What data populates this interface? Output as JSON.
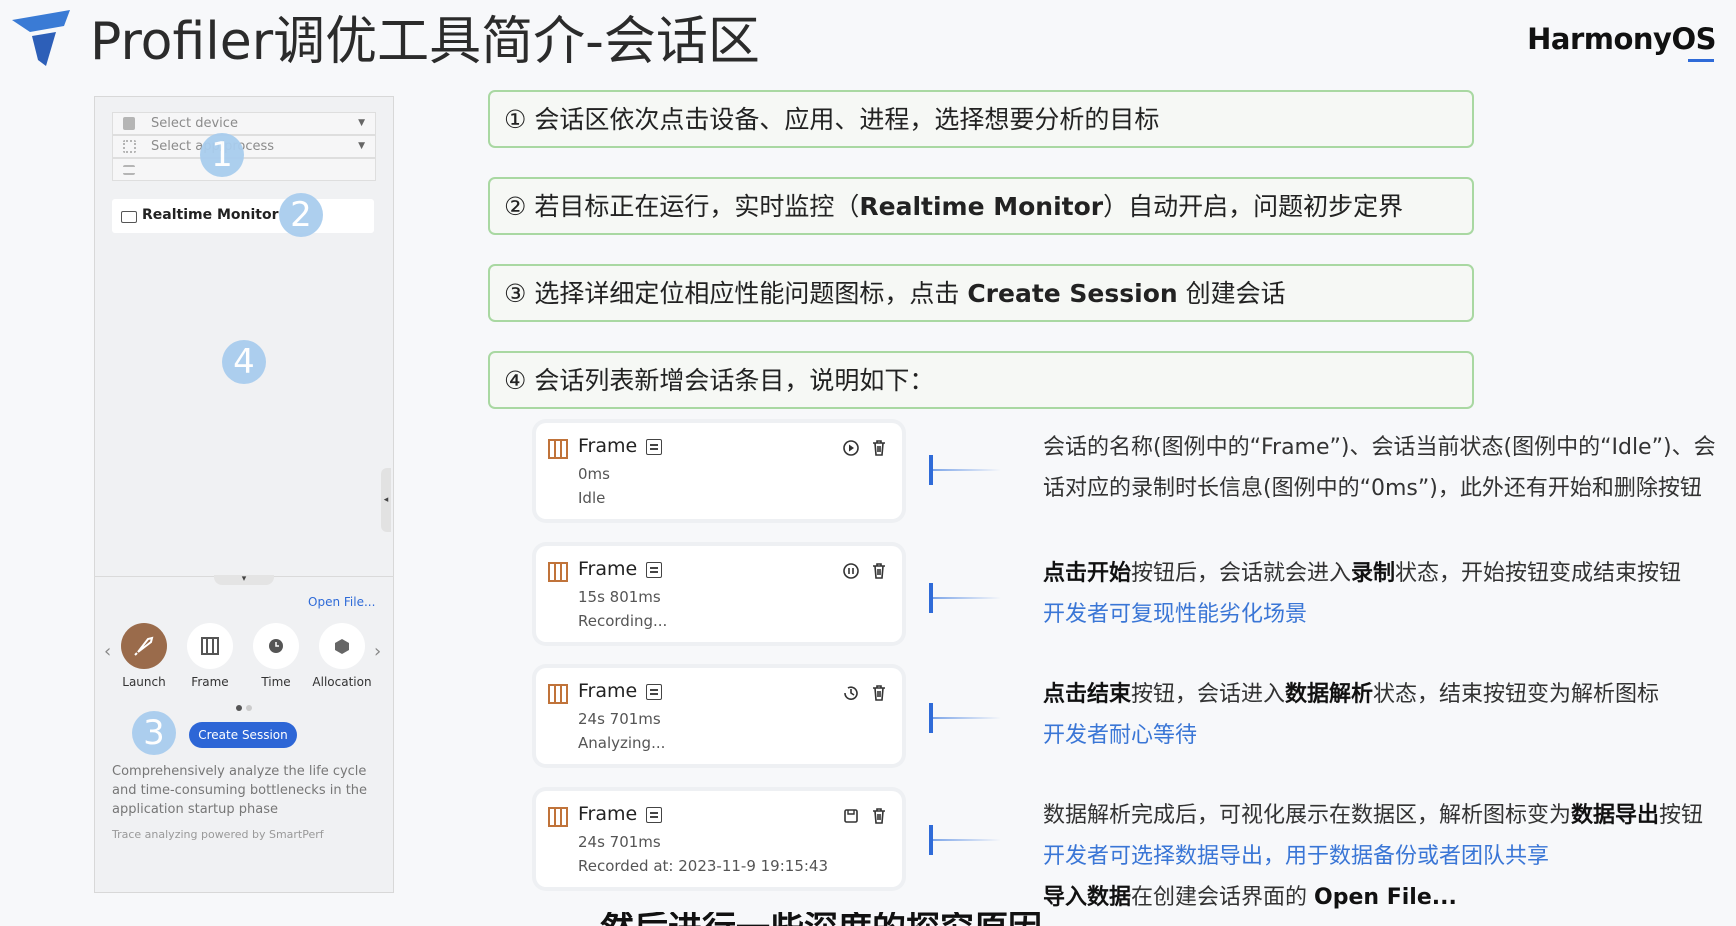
{
  "header": {
    "title": "Profiler调优工具简介-会话区",
    "brand": "HarmonyOS"
  },
  "panel": {
    "select_device": "Select device",
    "select_process": "Select app/process",
    "realtime_monitor": "Realtime Monitor",
    "open_file": "Open File...",
    "tools": [
      {
        "label": "Launch",
        "icon": "rocket-icon"
      },
      {
        "label": "Frame",
        "icon": "frame-icon"
      },
      {
        "label": "Time",
        "icon": "clock-icon"
      },
      {
        "label": "Allocation",
        "icon": "cube-icon"
      }
    ],
    "create_session": "Create Session",
    "description": "Comprehensively analyze the life cycle and time-consuming bottlenecks in the application startup phase",
    "footer": "Trace analyzing powered by SmartPerf",
    "badges": [
      "1",
      "2",
      "3",
      "4"
    ]
  },
  "callouts": {
    "c1": "① 会话区依次点击设备、应用、进程，选择想要分析的目标",
    "c2_pre": "② 若目标正在运行，实时监控（",
    "c2_bold": "Realtime Monitor",
    "c2_post": "）自动开启，问题初步定界",
    "c3_pre": "③ 选择详细定位相应性能问题图标，点击 ",
    "c3_bold": "Create Session",
    "c3_post": " 创建会话",
    "c4": "④ 会话列表新增会话条目，说明如下："
  },
  "sessions": [
    {
      "name": "Frame",
      "duration": "0ms",
      "state": "Idle"
    },
    {
      "name": "Frame",
      "duration": "15s 801ms",
      "state": "Recording..."
    },
    {
      "name": "Frame",
      "duration": "24s 701ms",
      "state": "Analyzing..."
    },
    {
      "name": "Frame",
      "duration": "24s 701ms",
      "state": "Recorded at: 2023-11-9 19:15:43"
    }
  ],
  "descriptions": {
    "d1_l1": "会话的名称(图例中的“Frame”)、会话当前状态(图例中的“Idle”)、会",
    "d1_l2": "话对应的录制时长信息(图例中的“0ms”)，此外还有开始和删除按钮",
    "d2_a": "点击开始",
    "d2_b": "按钮后，会话就会进入",
    "d2_c": "录制",
    "d2_d": "状态，开始按钮变成结束按钮",
    "d2_l2": "开发者可复现性能劣化场景",
    "d3_a": "点击结束",
    "d3_b": "按钮，会话进入",
    "d3_c": "数据解析",
    "d3_d": "状态，结束按钮变为解析图标",
    "d3_l2": "开发者耐心等待",
    "d4_a": "数据解析完成后，可视化展示在数据区，解析图标变为",
    "d4_b": "数据导出",
    "d4_c": "按钮",
    "d4_l2": "开发者可选择数据导出，用于数据备份或者团队共享",
    "d4_l3a": "导入数据",
    "d4_l3b": "在创建会话界面的 ",
    "d4_l3c": "Open File..."
  },
  "subtitle": "然后进行一些深度的探究原因"
}
